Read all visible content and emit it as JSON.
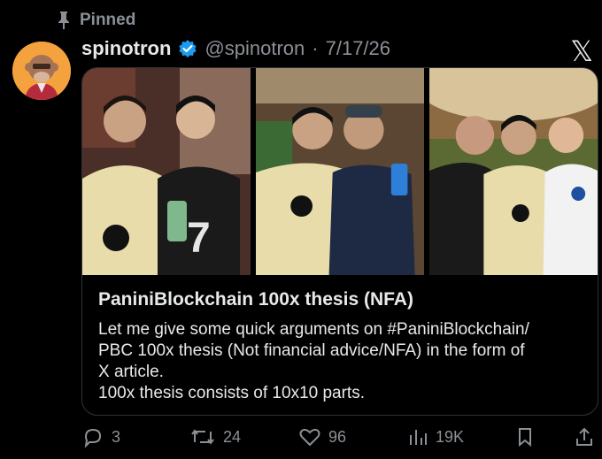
{
  "pinned_label": "Pinned",
  "user": {
    "display_name": "spinotron",
    "handle": "@spinotron",
    "separator": "·",
    "date": "7/17/26"
  },
  "platform_logo": "𝕏",
  "article": {
    "title": "PaniniBlockchain 100x thesis (NFA)",
    "text": "Let me give some quick arguments on #PaniniBlockchain/\nPBC 100x thesis (Not financial advice/NFA) in the form of\nX article.\n100x thesis consists of 10x10 parts."
  },
  "actions": {
    "replies": "3",
    "reposts": "24",
    "likes": "96",
    "views": "19K"
  },
  "icons": [
    "pin-icon",
    "verified-icon",
    "x-logo-icon",
    "reply-icon",
    "repost-icon",
    "like-icon",
    "views-icon",
    "bookmark-icon",
    "share-icon"
  ],
  "colors": {
    "background": "#000000",
    "text": "#e7e9ea",
    "muted": "#8b9096",
    "verified": "#1d9bf0",
    "border": "#2f3336"
  }
}
